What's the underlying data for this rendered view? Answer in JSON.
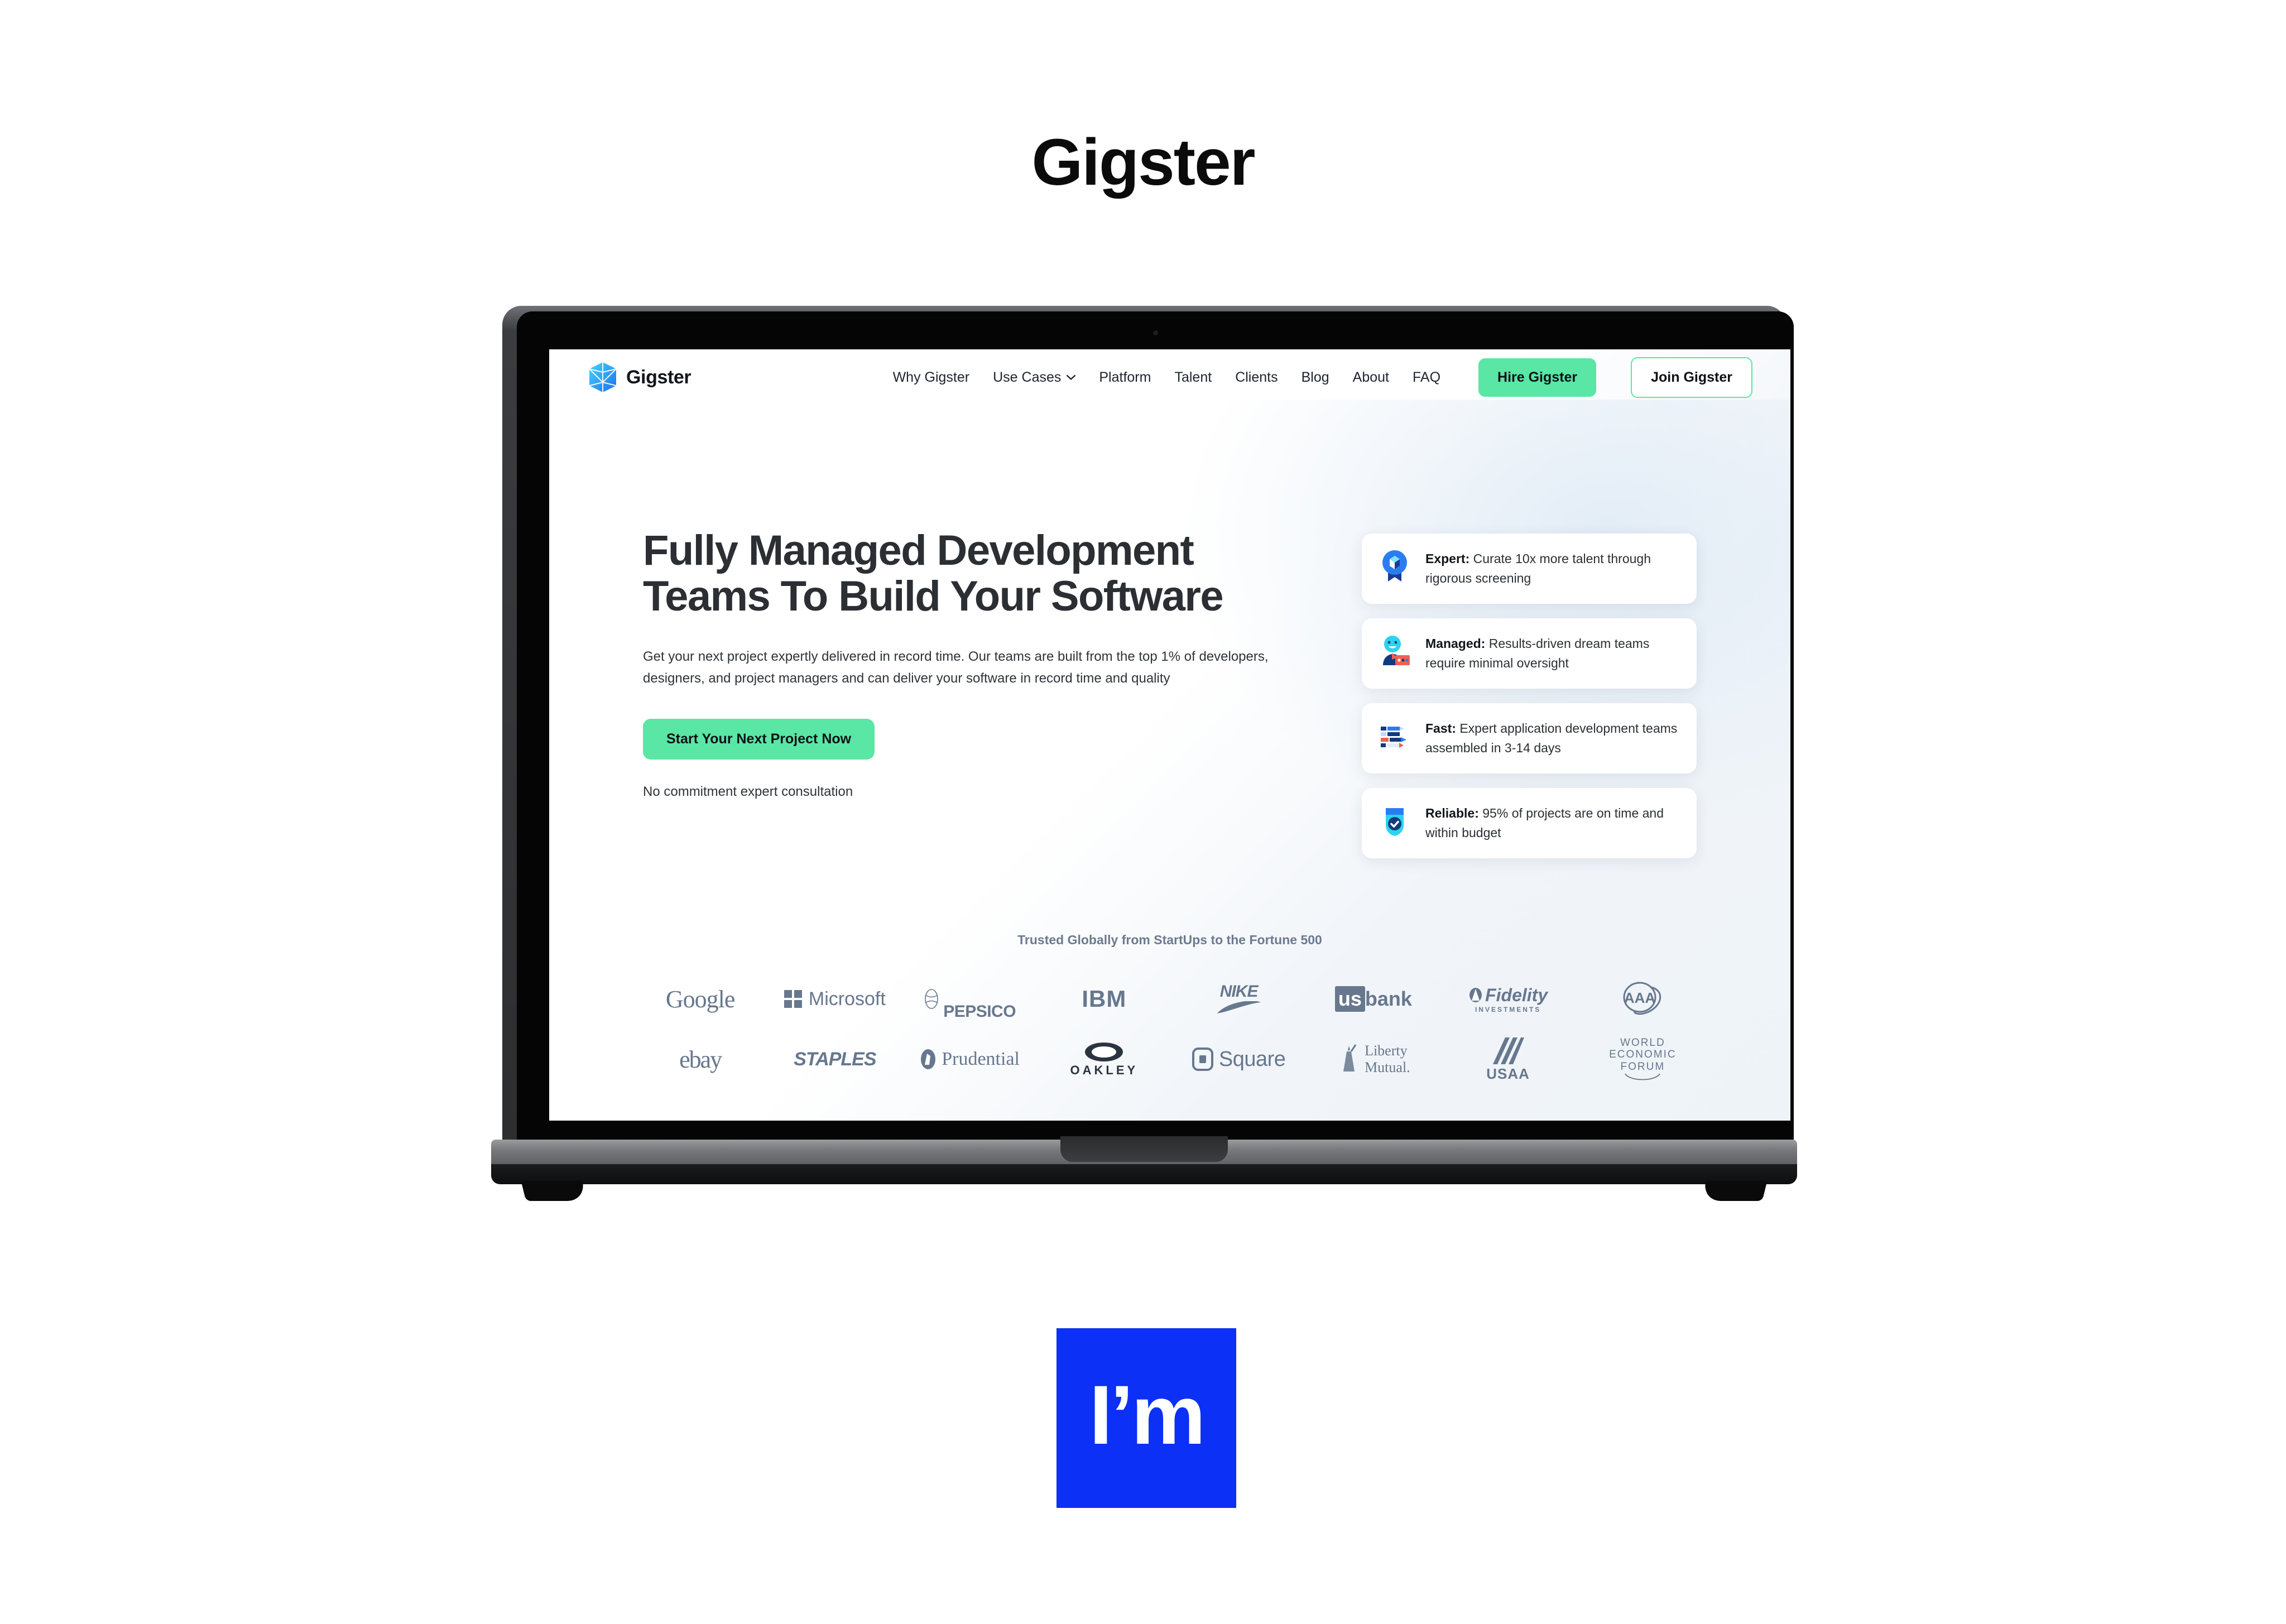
{
  "brand": {
    "title": "Gigster"
  },
  "site": {
    "logo": {
      "text": "Gigster",
      "icon": "gigster-gem-icon"
    },
    "nav": {
      "links": [
        {
          "label": "Why Gigster",
          "has_chevron": false
        },
        {
          "label": "Use Cases",
          "has_chevron": true
        },
        {
          "label": "Platform",
          "has_chevron": false
        },
        {
          "label": "Talent",
          "has_chevron": false
        },
        {
          "label": "Clients",
          "has_chevron": false
        },
        {
          "label": "Blog",
          "has_chevron": false
        },
        {
          "label": "About",
          "has_chevron": false
        },
        {
          "label": "FAQ",
          "has_chevron": false
        }
      ],
      "primary_button": "Hire Gigster",
      "outline_button": "Join Gigster"
    },
    "hero": {
      "headline_line1": "Fully Managed Development",
      "headline_line2": "Teams To Build Your Software",
      "subtext": "Get your next project expertly delivered in record time. Our teams are built from the top 1% of developers, designers, and project managers and can deliver your software in record time and quality",
      "cta_label": "Start Your Next Project Now",
      "cta_note": "No commitment expert consultation"
    },
    "feature_cards": [
      {
        "icon": "badge-ribbon-icon",
        "title": "Expert:",
        "body": "Curate 10x more talent through rigorous screening"
      },
      {
        "icon": "person-chat-icon",
        "title": "Managed:",
        "body": "Results-driven dream teams require minimal oversight"
      },
      {
        "icon": "gantt-bars-icon",
        "title": "Fast:",
        "body": "Expert application development teams assembled in 3-14 days"
      },
      {
        "icon": "shield-check-icon",
        "title": "Reliable:",
        "body": "95% of projects are on time and within budget"
      }
    ],
    "trusted_label": "Trusted Globally from StartUps to the Fortune 500",
    "client_logos_row1": [
      "Google",
      "Microsoft",
      "PEPSICO",
      "IBM",
      "NIKE",
      "usbank",
      "Fidelity INVESTMENTS",
      "AAA"
    ],
    "client_logos_row2": [
      "ebay",
      "STAPLES",
      "Prudential",
      "OAKLEY",
      "Square",
      "Liberty Mutual",
      "USAA",
      "WORLD ECONOMIC FORUM"
    ]
  },
  "bottom_mark": {
    "text": "I’m",
    "background": "#0c30f5",
    "color": "#ffffff"
  },
  "colors": {
    "accent_green": "#5ae6a4",
    "logo_blue": "#2f9bf5",
    "text_dark": "#2b2f33",
    "logo_gray": "#67778e",
    "brand_blue": "#0c30f5"
  }
}
